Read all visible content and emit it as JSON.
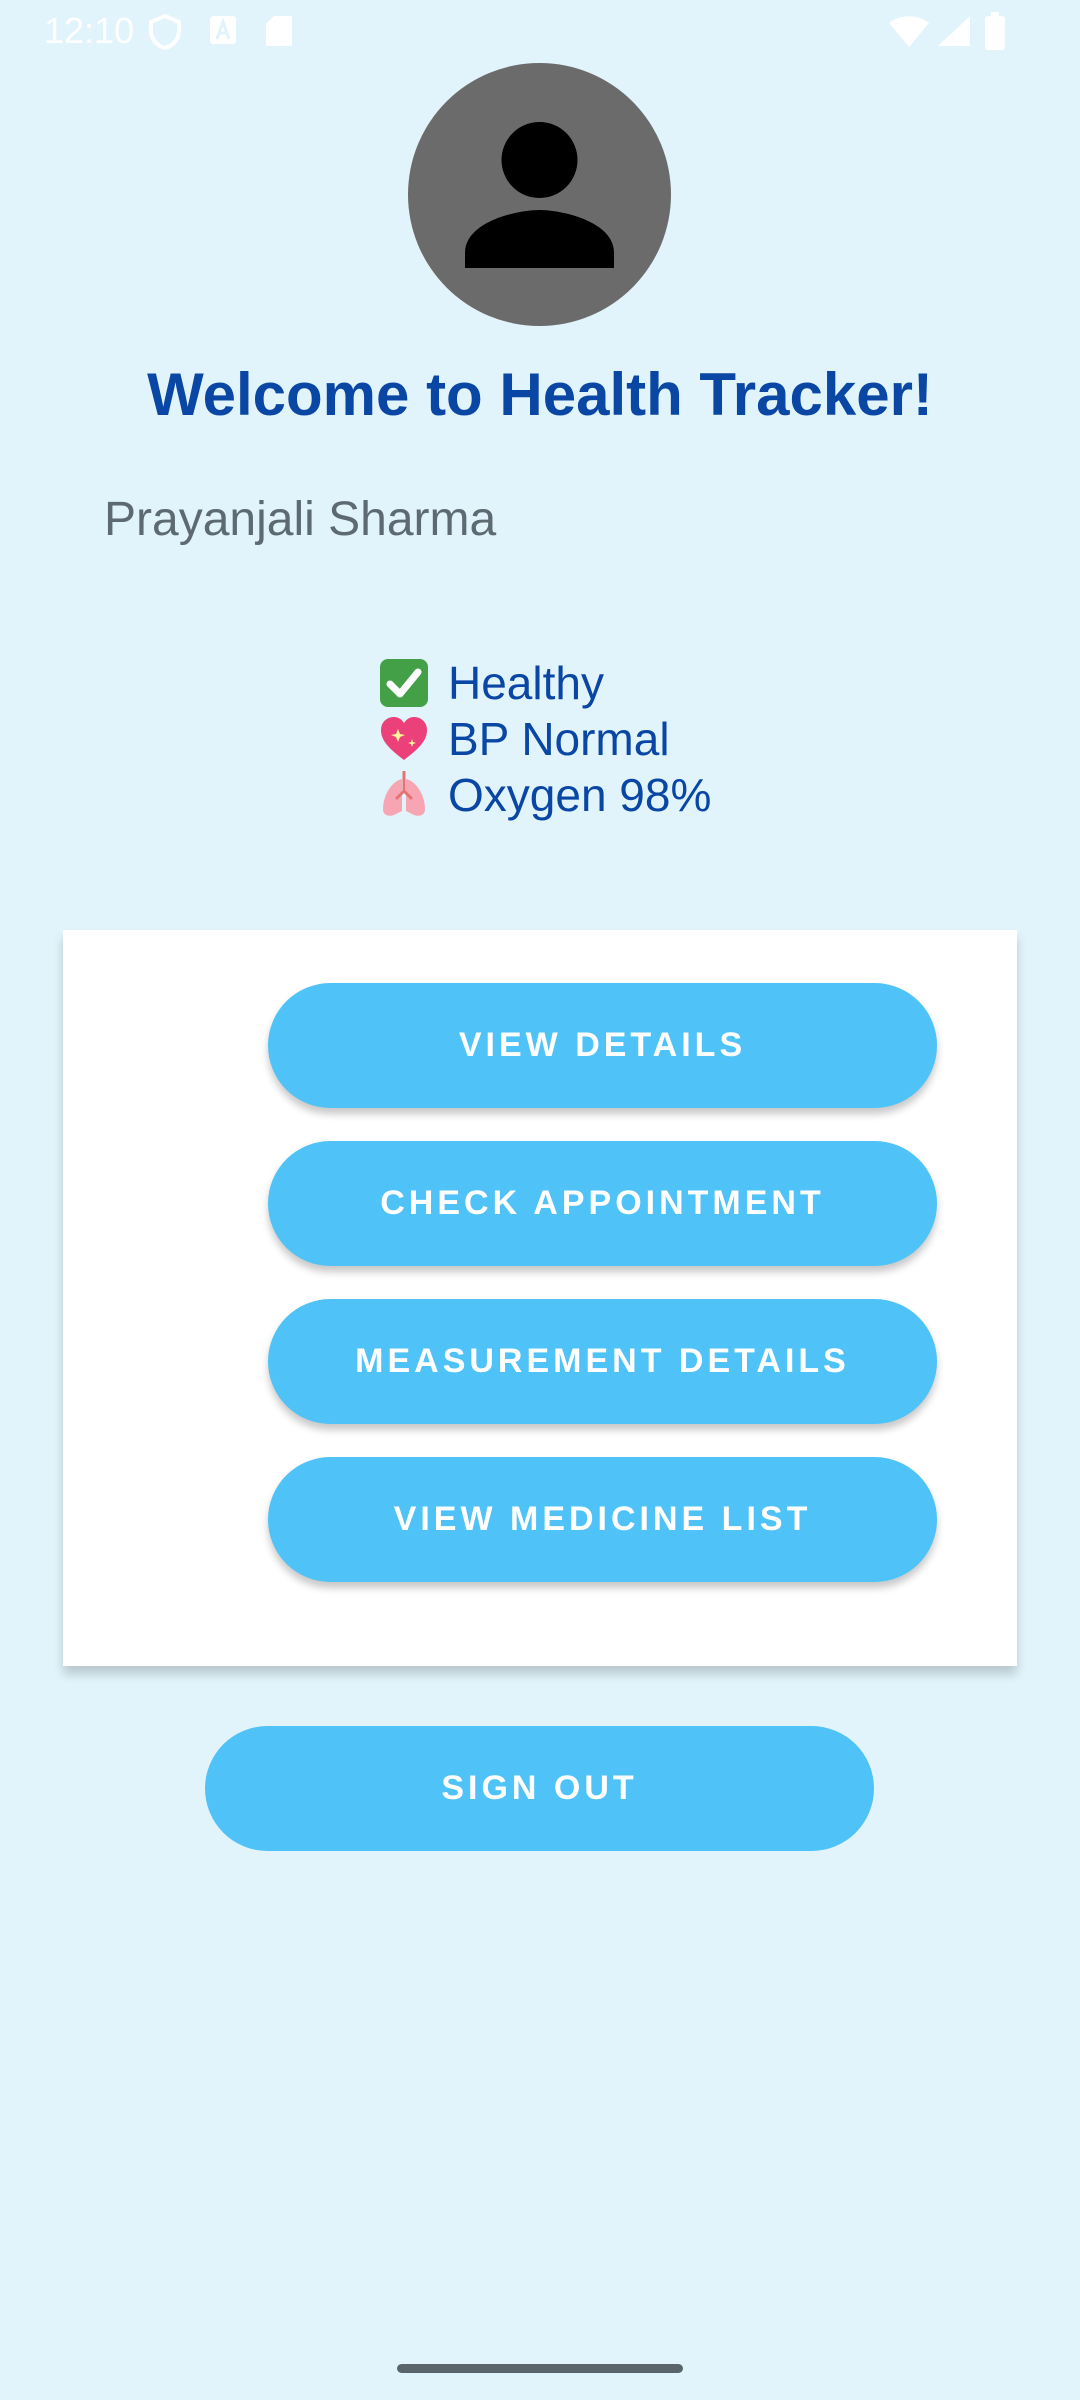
{
  "status_bar": {
    "time": "12:10",
    "left_icons": [
      "shield-icon",
      "a-letter-icon",
      "sd-card-icon"
    ],
    "right_icons": [
      "wifi-icon",
      "signal-icon",
      "battery-icon"
    ]
  },
  "avatar": {
    "icon": "person-icon",
    "bg_color": "#6b6b6b"
  },
  "header": {
    "title": "Welcome to Health Tracker!",
    "title_color": "#0a47a5"
  },
  "user": {
    "name": "Prayanjali Sharma"
  },
  "health_status": [
    {
      "icon": "check-mark-emoji",
      "label": "Healthy"
    },
    {
      "icon": "sparkling-heart-emoji",
      "label": "BP Normal"
    },
    {
      "icon": "lungs-emoji",
      "label": "Oxygen 98%"
    }
  ],
  "actions": {
    "view_details": "VIEW DETAILS",
    "check_appointment": "CHECK APPOINTMENT",
    "measurement_details": "MEASUREMENT DETAILS",
    "view_medicine_list": "VIEW MEDICINE LIST"
  },
  "sign_out": "SIGN OUT",
  "colors": {
    "background": "#e1f4fb",
    "button": "#4fc3f7",
    "card": "#ffffff"
  }
}
